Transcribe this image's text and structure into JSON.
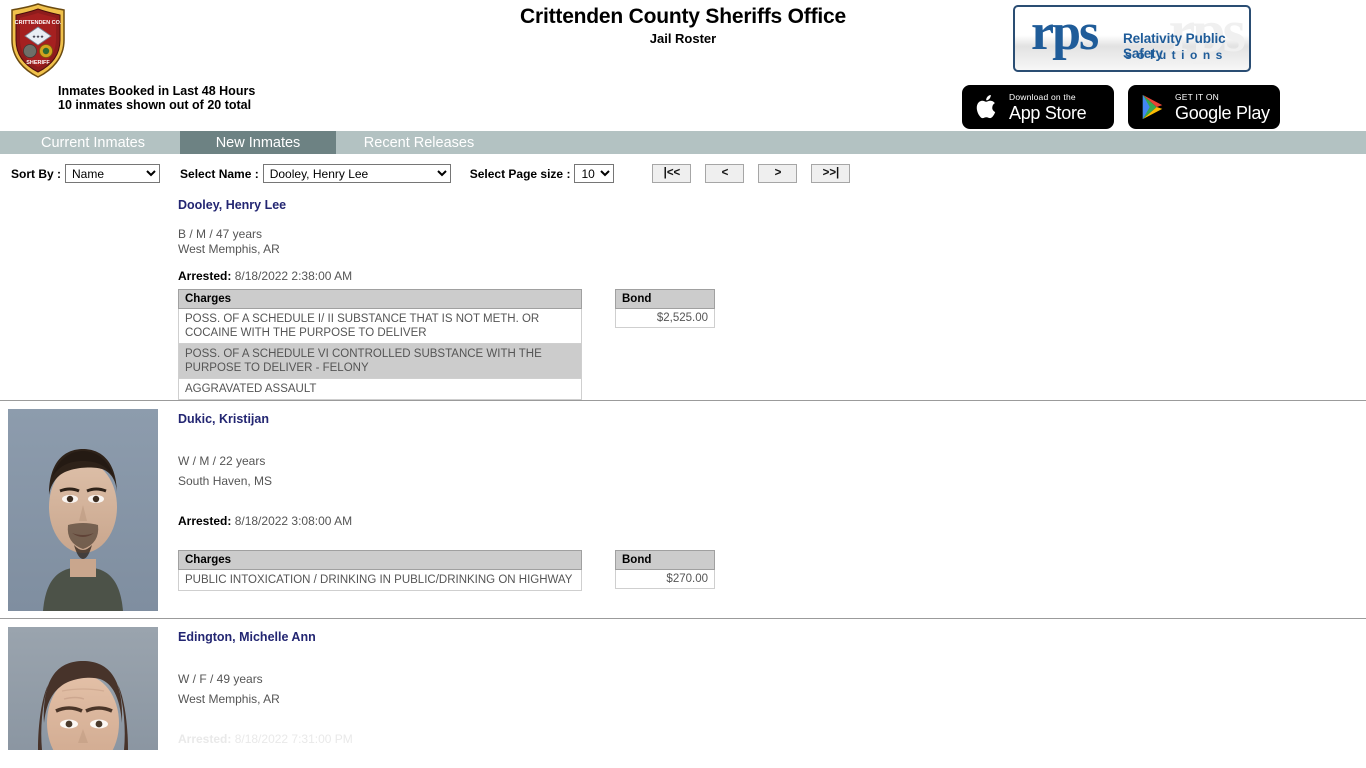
{
  "header": {
    "title": "Crittenden County Sheriffs Office",
    "subtitle": "Jail Roster",
    "booked_line1": "Inmates Booked in Last 48 Hours",
    "booked_line2": "10 inmates shown out of 20 total",
    "badge_icon": "sheriff-badge-icon",
    "logo": {
      "mark": "rps",
      "ghost": "rps",
      "tagline1": "Relativity Public Safety",
      "tagline2": "solutions"
    },
    "app_store": {
      "small": "Download on the",
      "big": "App Store",
      "icon": "apple-icon"
    },
    "google_play": {
      "small": "GET IT ON",
      "big": "Google Play",
      "icon": "google-play-icon"
    }
  },
  "tabs": [
    {
      "label": "Current Inmates",
      "active": false
    },
    {
      "label": "New Inmates",
      "active": true
    },
    {
      "label": "Recent Releases",
      "active": false
    }
  ],
  "controls": {
    "sort_by_label": "Sort By :",
    "sort_by_value": "Name",
    "sort_by_options": [
      "Name"
    ],
    "select_name_label": "Select Name :",
    "select_name_value": "Dooley, Henry Lee",
    "select_name_options": [
      "Dooley, Henry Lee"
    ],
    "page_size_label": "Select Page size :",
    "page_size_value": "10",
    "page_size_options": [
      "10"
    ],
    "pager": {
      "first": "|<<",
      "prev": "<",
      "next": ">",
      "last": ">>|"
    }
  },
  "table_headers": {
    "charges": "Charges",
    "bond": "Bond"
  },
  "records": [
    {
      "name": "Dooley, Henry Lee",
      "demographics": "B / M / 47 years",
      "city": "West Memphis, AR",
      "arrested_label": "Arrested:",
      "arrested_value": "8/18/2022 2:38:00 AM",
      "has_photo": false,
      "charges": [
        "POSS. OF A SCHEDULE I/ II SUBSTANCE THAT IS NOT METH. OR COCAINE WITH THE PURPOSE TO DELIVER",
        "POSS. OF A SCHEDULE VI CONTROLLED SUBSTANCE WITH THE PURPOSE TO DELIVER - FELONY",
        "AGGRAVATED ASSAULT"
      ],
      "bond": "$2,525.00"
    },
    {
      "name": "Dukic, Kristijan",
      "demographics": "W / M / 22 years",
      "city": "South Haven, MS",
      "arrested_label": "Arrested:",
      "arrested_value": "8/18/2022 3:08:00 AM",
      "has_photo": true,
      "charges": [
        "PUBLIC INTOXICATION / DRINKING IN PUBLIC/DRINKING ON HIGHWAY"
      ],
      "bond": "$270.00"
    },
    {
      "name": "Edington, Michelle Ann",
      "demographics": "W / F / 49 years",
      "city": "West Memphis, AR",
      "arrested_label": "Arrested:",
      "arrested_value": "8/18/2022 7:31:00 PM",
      "has_photo": true,
      "charges": [],
      "bond": ""
    }
  ],
  "colors": {
    "tabbar_bg": "#b3c2c2",
    "tab_active_bg": "#6d8283",
    "name_link": "#232672",
    "table_header_bg": "#cccccc",
    "logo_blue": "#1f5c99"
  }
}
